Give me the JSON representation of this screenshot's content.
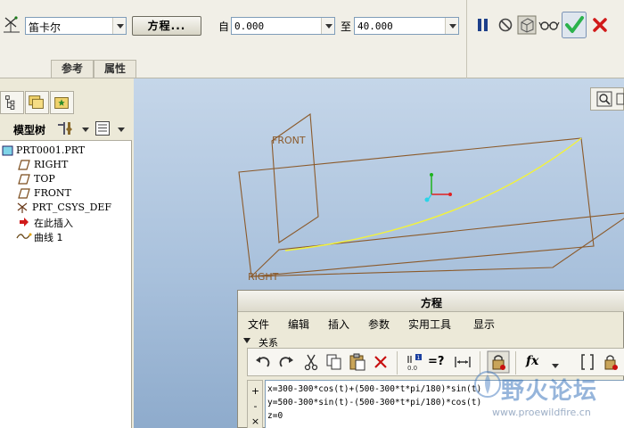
{
  "dashboard": {
    "coord_system_value": "笛卡尔",
    "equation_button": "方程...",
    "from_label": "自",
    "from_value": "0.000",
    "to_label": "至",
    "to_value": "40.000",
    "tabs": [
      "参考",
      "属性"
    ],
    "accent_ok": "#2bb24c",
    "accent_cancel": "#d11a1a"
  },
  "navigator": {
    "title": "模型树",
    "items": [
      {
        "label": "PRT0001.PRT",
        "icon": "part-icon"
      },
      {
        "label": "RIGHT",
        "icon": "datum-plane-icon"
      },
      {
        "label": "TOP",
        "icon": "datum-plane-icon"
      },
      {
        "label": "FRONT",
        "icon": "datum-plane-icon"
      },
      {
        "label": "PRT_CSYS_DEF",
        "icon": "csys-icon"
      },
      {
        "label": "在此插入",
        "icon": "insert-here-arrow-icon"
      },
      {
        "label": "曲线 1",
        "icon": "curve-icon"
      }
    ]
  },
  "graphics": {
    "label_front": "FRONT",
    "label_right": "RIGHT"
  },
  "equation_dialog": {
    "title": "方程",
    "menus": [
      "文件",
      "编辑",
      "插入",
      "参数",
      "实用工具",
      "显示"
    ],
    "section": "关系",
    "equations": [
      "x=300-300*cos(t)+(500-300*t*pi/180)*sin(t)",
      "y=500-300*sin(t)-(500-300*t*pi/180)*cos(t)",
      "z=0"
    ],
    "side_buttons": [
      "+",
      "-",
      "×"
    ],
    "eval_label": "=?",
    "fx_label": "fx",
    "param_label": "0.0"
  },
  "watermark": {
    "text": "野火论坛",
    "url": "www.proewildfire.cn"
  }
}
